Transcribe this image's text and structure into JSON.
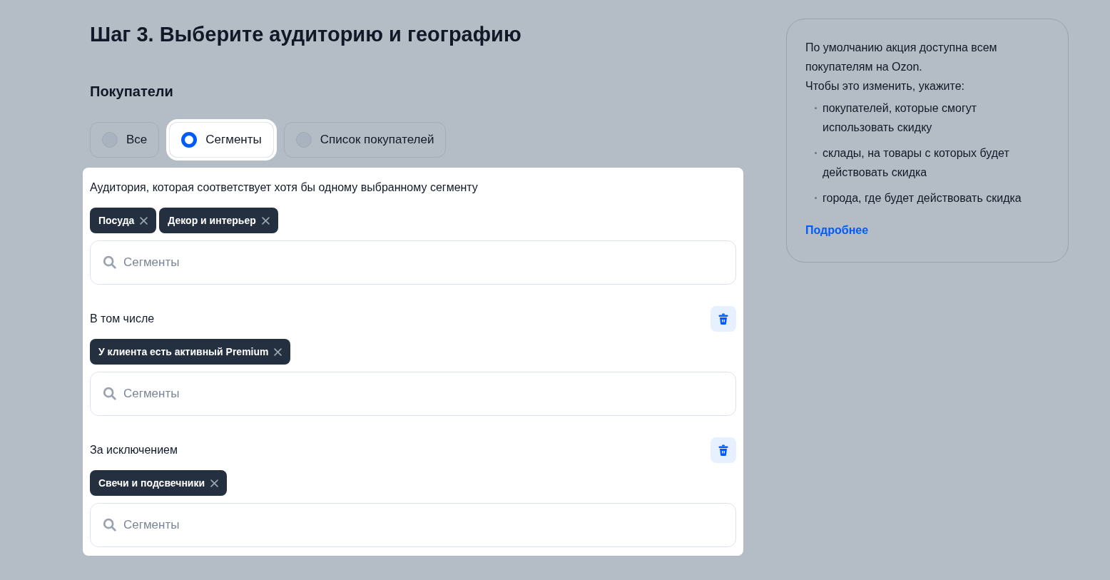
{
  "title": "Шаг 3. Выберите аудиторию и географию",
  "section_title": "Покупатели",
  "options": [
    {
      "label": "Все",
      "selected": false
    },
    {
      "label": "Сегменты",
      "selected": true
    },
    {
      "label": "Список покупателей",
      "selected": false
    }
  ],
  "groups": [
    {
      "label": "Аудитория, которая соответствует хотя бы одному выбранному сегменту",
      "deletable": false,
      "tags": [
        "Посуда",
        "Декор и интерьер"
      ],
      "placeholder": "Сегменты"
    },
    {
      "label": "В том числе",
      "deletable": true,
      "tags": [
        "У клиента есть активный Premium"
      ],
      "placeholder": "Сегменты"
    },
    {
      "label": "За исключением",
      "deletable": true,
      "tags": [
        "Свечи и подсвечники"
      ],
      "placeholder": "Сегменты"
    }
  ],
  "info": {
    "lines": [
      "По умолчанию акция доступна всем покупателям на Ozon.",
      "Чтобы это изменить, укажите:"
    ],
    "bullets": [
      "покупателей, которые смогут использовать скидку",
      "склады, на товары с которых будет действовать скидка",
      "города, где будет действовать скидка"
    ],
    "link": "Подробнее"
  }
}
